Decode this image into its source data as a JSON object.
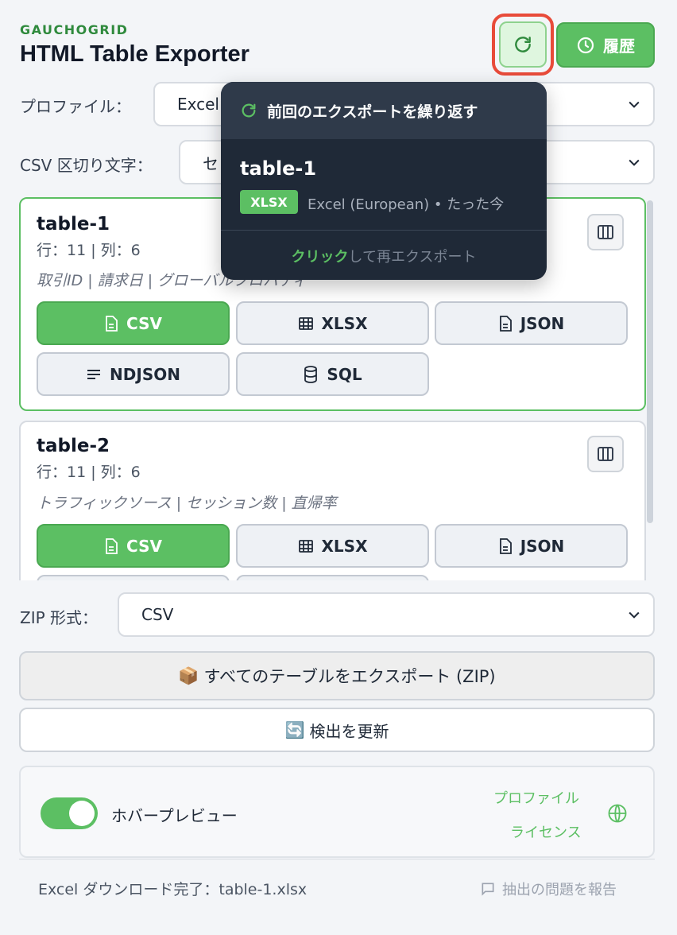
{
  "header": {
    "brand": "GAUCHOGRID",
    "title": "HTML Table Exporter",
    "history_label": "履歴"
  },
  "profile": {
    "label": "プロファイル：",
    "value": "Excel"
  },
  "csv_delimiter": {
    "label": "CSV 区切り文字：",
    "value": "セ"
  },
  "tables": [
    {
      "name": "table-1",
      "meta": "行：11 | 列：6",
      "columns": "取引ID | 請求日 | グローバルプロパティ",
      "buttons": [
        "CSV",
        "XLSX",
        "JSON",
        "NDJSON",
        "SQL"
      ]
    },
    {
      "name": "table-2",
      "meta": "行：11 | 列：6",
      "columns": "トラフィックソース | セッション数 | 直帰率",
      "buttons": [
        "CSV",
        "XLSX",
        "JSON"
      ]
    }
  ],
  "zip": {
    "label": "ZIP 形式：",
    "value": "CSV"
  },
  "export_all": {
    "icon": "📦",
    "label": "すべてのテーブルをエクスポート (ZIP)"
  },
  "refresh_detect": {
    "icon": "🔄",
    "label": "検出を更新"
  },
  "footer": {
    "hover_preview_label": "ホバープレビュー",
    "profile_link": "プロファイル",
    "license_link": "ライセンス"
  },
  "status_text": "Excel ダウンロード完了：table-1.xlsx",
  "report_link": "抽出の問題を報告",
  "popover": {
    "title": "前回のエクスポートを繰り返す",
    "table_name": "table-1",
    "badge": "XLSX",
    "meta": "Excel (European)  •  たった今",
    "footer_em": "クリック",
    "footer_rest": "して再エクスポート"
  },
  "colors": {
    "accent": "#5cbf63",
    "highlight": "#e84b3a",
    "popover_bg": "#1f2937"
  }
}
